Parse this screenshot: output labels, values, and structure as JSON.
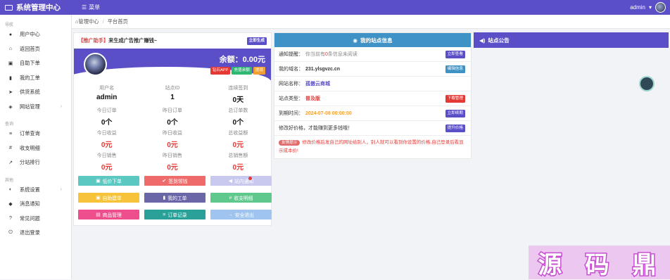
{
  "topbar": {
    "title": "系统管理中心",
    "menu_label": "菜单",
    "username": "admin",
    "caret": "▾"
  },
  "sidebar": {
    "groups": [
      {
        "label": "导航",
        "items": [
          {
            "label": "用户中心",
            "icon": "user-icon"
          },
          {
            "label": "返回首页",
            "icon": "home-icon"
          },
          {
            "label": "自助下单",
            "icon": "cart-icon"
          },
          {
            "label": "我的工单",
            "icon": "bookmark-icon"
          },
          {
            "label": "供货系统",
            "icon": "send-icon"
          },
          {
            "label": "网站管理",
            "icon": "cube-icon",
            "arrow": true
          }
        ]
      },
      {
        "label": "查询",
        "items": [
          {
            "label": "订单查询",
            "icon": "list-icon"
          },
          {
            "label": "收支明细",
            "icon": "hash-icon"
          },
          {
            "label": "分站排行",
            "icon": "chart-icon"
          }
        ]
      },
      {
        "label": "其他",
        "items": [
          {
            "label": "系统设置",
            "icon": "gear-icon",
            "arrow": true
          },
          {
            "label": "消息通知",
            "icon": "bell-icon"
          },
          {
            "label": "常见问题",
            "icon": "question-icon"
          },
          {
            "label": "退出登录",
            "icon": "power-icon"
          }
        ]
      }
    ]
  },
  "breadcrumb": {
    "home": "管理中心",
    "sep": "/",
    "current": "平台首页"
  },
  "promo": {
    "tag": "【推广助手】",
    "text": "来生成广告推广赚钱~",
    "button": "立即生成"
  },
  "banner": {
    "balance_label": "余额：",
    "balance": "0.00元",
    "buttons": [
      "钻石APP",
      "充值余额",
      "提现"
    ]
  },
  "stats": [
    {
      "label": "用户名",
      "value": "admin",
      "red": false
    },
    {
      "label": "站点ID",
      "value": "1",
      "red": false
    },
    {
      "label": "连续签到",
      "value": "0天",
      "red": false
    },
    {
      "label": "今日订单",
      "value": "0个",
      "red": false
    },
    {
      "label": "昨日订单",
      "value": "0个",
      "red": false
    },
    {
      "label": "总订单数",
      "value": "0个",
      "red": false
    },
    {
      "label": "今日收益",
      "value": "0元",
      "red": true
    },
    {
      "label": "昨日收益",
      "value": "0元",
      "red": true
    },
    {
      "label": "总收益额",
      "value": "0元",
      "red": true
    },
    {
      "label": "今日销售",
      "value": "0元",
      "red": true
    },
    {
      "label": "昨日销售",
      "value": "0元",
      "red": true
    },
    {
      "label": "总销售额",
      "value": "0元",
      "red": true
    }
  ],
  "actions": [
    {
      "label": "低价下单",
      "icon": "cart-icon",
      "color": "#5bc8c2"
    },
    {
      "label": "签到领钱",
      "icon": "check-icon",
      "color": "#ef6a6a"
    },
    {
      "label": "站内通知",
      "icon": "megaphone-icon",
      "color": "#c9c8ef",
      "dot": true
    },
    {
      "label": "自助建单",
      "icon": "cart-icon",
      "color": "#f6c33b"
    },
    {
      "label": "我的工单",
      "icon": "bookmark-icon",
      "color": "#6b66a8"
    },
    {
      "label": "收支明细",
      "icon": "hash-icon",
      "color": "#5fc98d"
    },
    {
      "label": "商品管理",
      "icon": "box-icon",
      "color": "#ee4e8c"
    },
    {
      "label": "订单记录",
      "icon": "list-icon",
      "color": "#2aa198"
    },
    {
      "label": "安全退出",
      "icon": "exit-icon",
      "color": "#9fc4f0"
    }
  ],
  "site_info": {
    "title": "我的站点信息",
    "header_color": "#3f92c6",
    "notice": {
      "label": "通知提醒：",
      "pre": "你当前有",
      "count": "0",
      "post": "条信息未阅读",
      "button": "立即查看"
    },
    "domain": {
      "label": "我的域名：",
      "value": "231.ylsgvzc.cn",
      "button": "编辑信息"
    },
    "name": {
      "label": "网站名称：",
      "value": "孤傲云商城"
    },
    "type": {
      "label": "站点类型：",
      "value": "普及版",
      "button": "下载管理"
    },
    "expire": {
      "label": "到期时间：",
      "value": "2024-07-08 00:00:00",
      "button": "立即续期"
    },
    "upgrade": {
      "text": "修改好价格，才能赚到更多钱哦！",
      "button": "提升价格"
    },
    "tip": {
      "badge": "友情提示",
      "text": "修改价格后发自己的网址给别人，别人就可以看到你设置的价格,自己登录后看显示成本价!"
    }
  },
  "announce": {
    "title": "站点公告",
    "header_color": "#5b4fc8"
  },
  "watermark": "源码鼎"
}
